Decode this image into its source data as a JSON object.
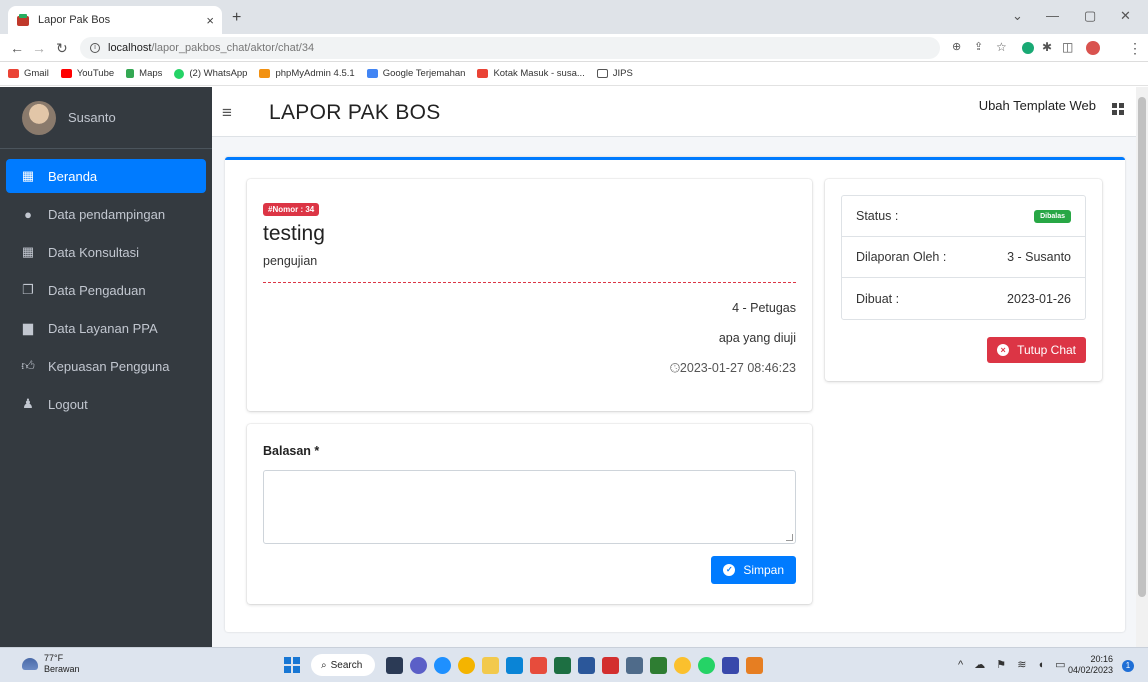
{
  "browser": {
    "tab_title": "Lapor Pak Bos",
    "tab_close": "×",
    "new_tab": "+",
    "url_host": "localhost",
    "url_path": "/lapor_pakbos_chat/aktor/chat/34",
    "bookmarks": [
      "Gmail",
      "YouTube",
      "Maps",
      "(2) WhatsApp",
      "phpMyAdmin 4.5.1",
      "Google Terjemahan",
      "Kotak Masuk - susa...",
      "JIPS"
    ]
  },
  "sidebar": {
    "user_name": "Susanto",
    "items": [
      {
        "label": "Beranda",
        "icon": "table-icon"
      },
      {
        "label": "Data pendampingan",
        "icon": "circle-icon"
      },
      {
        "label": "Data Konsultasi",
        "icon": "table-icon"
      },
      {
        "label": "Data Pengaduan",
        "icon": "copy-icon"
      },
      {
        "label": "Data Layanan PPA",
        "icon": "file-icon"
      },
      {
        "label": "Kepuasan Pengguna",
        "icon": "thumbs-up-icon"
      },
      {
        "label": "Logout",
        "icon": "person-icon"
      }
    ]
  },
  "header": {
    "brand": "LAPOR PAK BOS",
    "ubah_template": "Ubah Template Web"
  },
  "message": {
    "badge": "#Nomor : 34",
    "title": "testing",
    "description": "pengujian",
    "reply_author": "4 - Petugas",
    "reply_text": "apa yang diuji",
    "reply_time": "2023-01-27 08:46:23"
  },
  "form": {
    "label": "Balasan *",
    "save_label": "Simpan"
  },
  "info": {
    "status_label": "Status :",
    "status_value": "Dibalas",
    "reporter_label": "Dilaporan Oleh :",
    "reporter_value": "3 - Susanto",
    "created_label": "Dibuat :",
    "created_value": "2023-01-26",
    "close_label": "Tutup Chat"
  },
  "taskbar": {
    "temp": "77°F",
    "weather": "Berawan",
    "search": "Search",
    "time": "20:16",
    "date": "04/02/2023",
    "notifications": "1"
  },
  "colors": {
    "primary": "#007bff",
    "danger": "#dc3545",
    "success": "#28a745",
    "sidebar": "#343a40"
  }
}
